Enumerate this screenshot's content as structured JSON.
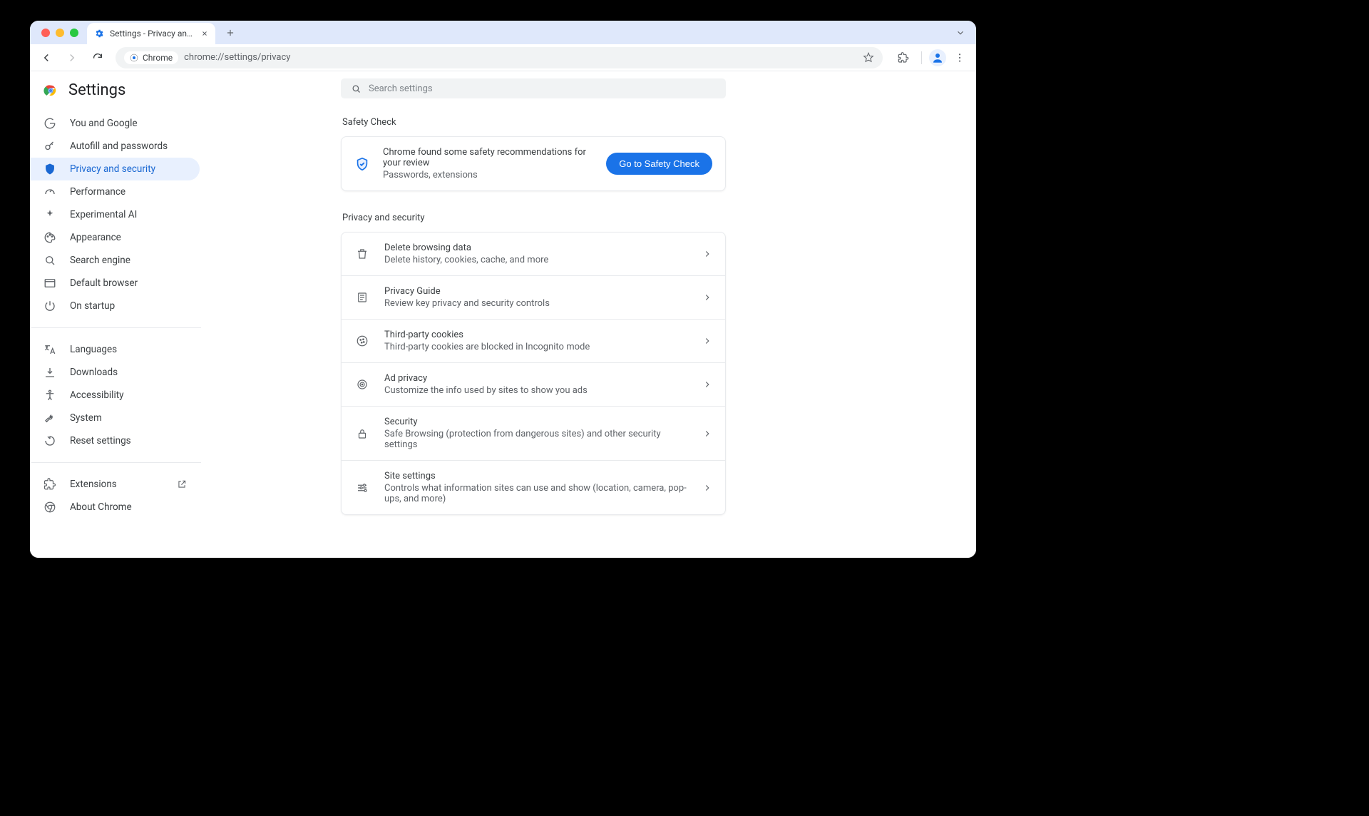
{
  "browser": {
    "tab_title": "Settings - Privacy and security",
    "chip_label": "Chrome",
    "address": "chrome://settings/privacy"
  },
  "app": {
    "title": "Settings",
    "search_placeholder": "Search settings"
  },
  "nav": {
    "items": [
      {
        "label": "You and Google"
      },
      {
        "label": "Autofill and passwords"
      },
      {
        "label": "Privacy and security"
      },
      {
        "label": "Performance"
      },
      {
        "label": "Experimental AI"
      },
      {
        "label": "Appearance"
      },
      {
        "label": "Search engine"
      },
      {
        "label": "Default browser"
      },
      {
        "label": "On startup"
      }
    ],
    "items2": [
      {
        "label": "Languages"
      },
      {
        "label": "Downloads"
      },
      {
        "label": "Accessibility"
      },
      {
        "label": "System"
      },
      {
        "label": "Reset settings"
      }
    ],
    "items3": [
      {
        "label": "Extensions"
      },
      {
        "label": "About Chrome"
      }
    ]
  },
  "safety": {
    "section_title": "Safety Check",
    "title": "Chrome found some safety recommendations for your review",
    "subtitle": "Passwords, extensions",
    "button": "Go to Safety Check"
  },
  "privacy": {
    "section_title": "Privacy and security",
    "rows": [
      {
        "title": "Delete browsing data",
        "subtitle": "Delete history, cookies, cache, and more"
      },
      {
        "title": "Privacy Guide",
        "subtitle": "Review key privacy and security controls"
      },
      {
        "title": "Third-party cookies",
        "subtitle": "Third-party cookies are blocked in Incognito mode"
      },
      {
        "title": "Ad privacy",
        "subtitle": "Customize the info used by sites to show you ads"
      },
      {
        "title": "Security",
        "subtitle": "Safe Browsing (protection from dangerous sites) and other security settings"
      },
      {
        "title": "Site settings",
        "subtitle": "Controls what information sites can use and show (location, camera, pop-ups, and more)"
      }
    ]
  }
}
